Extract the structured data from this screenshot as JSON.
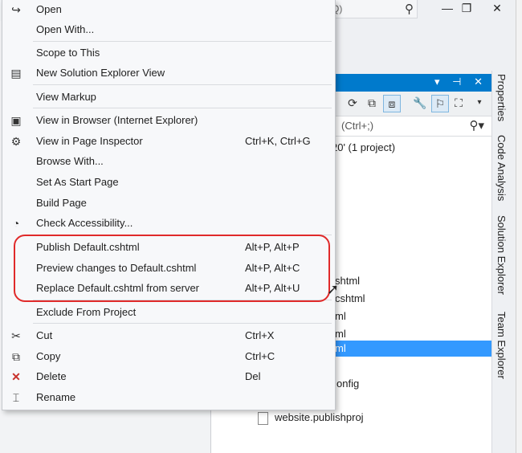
{
  "titlebar": {
    "quicklaunch_fragment": "Q)",
    "window_buttons": [
      "—",
      "❐",
      "✕"
    ]
  },
  "solution_explorer": {
    "search_placeholder_fragment": "(Ctrl+;)",
    "tree": [
      {
        "text": "20' (1 project)",
        "selected": false
      },
      {
        "text": "shtml",
        "selected": false
      },
      {
        "text": "cshtml",
        "selected": false
      },
      {
        "text": "ml",
        "selected": false
      },
      {
        "text": "ml",
        "selected": false
      },
      {
        "text": "ml",
        "selected": true
      },
      {
        "text": "onfig",
        "selected": false
      },
      {
        "text": "website.publishproj",
        "selected": false
      }
    ]
  },
  "side_tabs": [
    "Properties",
    "Code Analysis",
    "Solution Explorer",
    "Team Explorer"
  ],
  "context_menu": {
    "items": [
      {
        "icon": "redo-arrow-icon",
        "glyph": "↪",
        "label": "Open",
        "shortcut": ""
      },
      {
        "icon": "",
        "glyph": "",
        "label": "Open With...",
        "shortcut": ""
      },
      {
        "icon": "",
        "glyph": "",
        "label": "Scope to This",
        "shortcut": ""
      },
      {
        "icon": "new-solution-explorer-view-icon",
        "glyph": "▤",
        "label": "New Solution Explorer View",
        "shortcut": ""
      },
      {
        "icon": "",
        "glyph": "",
        "label": "View Markup",
        "shortcut": ""
      },
      {
        "icon": "view-in-browser-icon",
        "glyph": "▣",
        "label": "View in Browser (Internet Explorer)",
        "shortcut": ""
      },
      {
        "icon": "page-inspector-icon",
        "glyph": "⚙",
        "label": "View in Page Inspector",
        "shortcut": "Ctrl+K, Ctrl+G"
      },
      {
        "icon": "",
        "glyph": "",
        "label": "Browse With...",
        "shortcut": ""
      },
      {
        "icon": "",
        "glyph": "",
        "label": "Set As Start Page",
        "shortcut": ""
      },
      {
        "icon": "",
        "glyph": "",
        "label": "Build Page",
        "shortcut": ""
      },
      {
        "icon": "accessibility-icon",
        "glyph": "◔",
        "label": "Check Accessibility...",
        "shortcut": ""
      },
      {
        "icon": "",
        "glyph": "",
        "label": "Publish Default.cshtml",
        "shortcut": "Alt+P, Alt+P"
      },
      {
        "icon": "",
        "glyph": "",
        "label": "Preview changes to Default.cshtml",
        "shortcut": "Alt+P, Alt+C"
      },
      {
        "icon": "",
        "glyph": "",
        "label": "Replace Default.cshtml from server",
        "shortcut": "Alt+P, Alt+U"
      },
      {
        "icon": "",
        "glyph": "",
        "label": "Exclude From Project",
        "shortcut": ""
      },
      {
        "icon": "scissors-icon",
        "glyph": "✂",
        "label": "Cut",
        "shortcut": "Ctrl+X"
      },
      {
        "icon": "copy-icon",
        "glyph": "⧉",
        "label": "Copy",
        "shortcut": "Ctrl+C"
      },
      {
        "icon": "delete-x-icon",
        "glyph": "✕",
        "label": "Delete",
        "shortcut": "Del"
      },
      {
        "icon": "rename-icon",
        "glyph": "⌶",
        "label": "Rename",
        "shortcut": ""
      }
    ]
  },
  "colors": {
    "accent": "#007acc",
    "selection": "#3399ff",
    "highlight_ring": "#e02a2a",
    "delete_icon": "#c8312b"
  }
}
